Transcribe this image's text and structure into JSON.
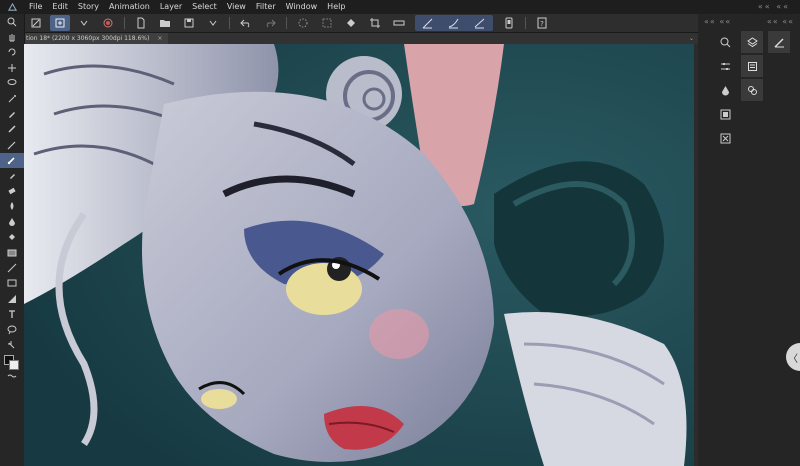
{
  "menu": {
    "items": [
      "File",
      "Edit",
      "Story",
      "Animation",
      "Layer",
      "Select",
      "View",
      "Filter",
      "Window",
      "Help"
    ],
    "right_controls": "«« ««"
  },
  "document_tab": {
    "title": "tion 18* (2200 x 3060px 300dpi 118.6%)",
    "close": "×",
    "menu": "⌄"
  },
  "dock": {
    "header_left": "«« ««",
    "header_right": "«« ««",
    "collapse": "〈"
  },
  "colors": {
    "menubar_bg": "#1e1e1e",
    "toolbar_bg": "#2e2e2e",
    "accent": "#4d6388",
    "canvas_bg": "#1c4048",
    "foreground_color": "#111111",
    "background_color": "#eeeeee"
  },
  "toolbar_icons": [
    "canvas-icon",
    "new-layer-icon",
    "chevron-down-icon",
    "record-icon",
    "new-file-icon",
    "open-folder-icon",
    "save-icon",
    "chevron-down-icon",
    "undo-icon",
    "redo-icon",
    "clear-selection-icon",
    "transform-icon",
    "fill-icon",
    "crop-icon",
    "selection-line-icon",
    "stabilize-icon",
    "vector-icon",
    "phone-icon",
    "help-icon"
  ],
  "tool_icons": [
    "zoom-icon",
    "hand-icon",
    "rotate-icon",
    "move-icon",
    "lasso-icon",
    "magic-wand-icon",
    "eyedropper-icon",
    "pen-icon",
    "pencil-icon",
    "brush-icon",
    "marker-icon",
    "eraser-icon",
    "blend-icon",
    "water-drop-icon",
    "fill-bucket-icon",
    "gradient-icon",
    "line-icon",
    "rectangle-icon",
    "frame-icon",
    "text-icon",
    "balloon-icon",
    "correction-icon"
  ],
  "dock_icons_col1": [
    "navigator-icon",
    "sliders-icon",
    "water-drop-icon",
    "frame-icon",
    "close-box-icon"
  ],
  "dock_icons_col2": [
    "layers-icon",
    "properties-icon",
    "layer-stack-icon"
  ],
  "dock_icons_col3": [
    "brush-size-icon"
  ]
}
